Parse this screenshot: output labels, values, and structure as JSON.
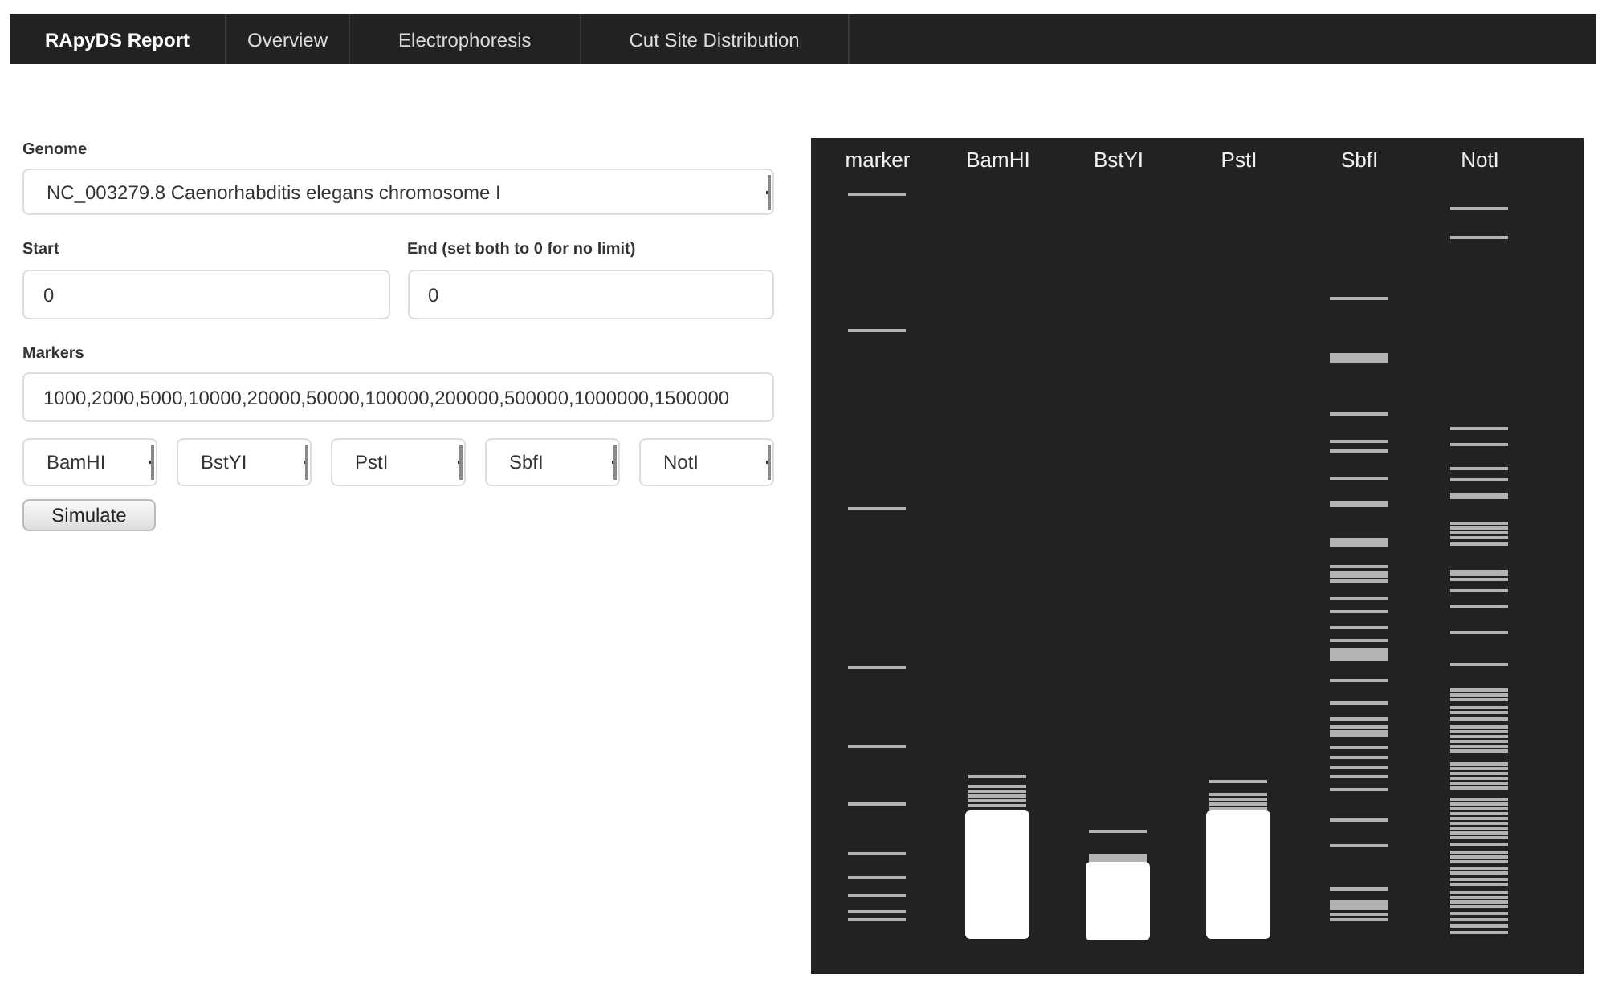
{
  "navbar": {
    "brand": "RApyDS Report",
    "links": [
      "Overview",
      "Electrophoresis",
      "Cut Site Distribution"
    ]
  },
  "form": {
    "genome": {
      "label": "Genome",
      "value": "NC_003279.8 Caenorhabditis elegans chromosome I"
    },
    "start": {
      "label": "Start",
      "value": "0"
    },
    "end": {
      "label": "End (set both to 0 for no limit)",
      "value": "0"
    },
    "markers": {
      "label": "Markers",
      "value": "1000,2000,5000,10000,20000,50000,100000,200000,500000,1000000,1500000"
    },
    "enzymes": [
      "BamHI",
      "BstYI",
      "PstI",
      "SbfI",
      "NotI"
    ],
    "button": "Simulate"
  },
  "gel": {
    "lanes": [
      "marker",
      "BamHI",
      "BstYI",
      "PstI",
      "SbfI",
      "NotI"
    ]
  }
}
